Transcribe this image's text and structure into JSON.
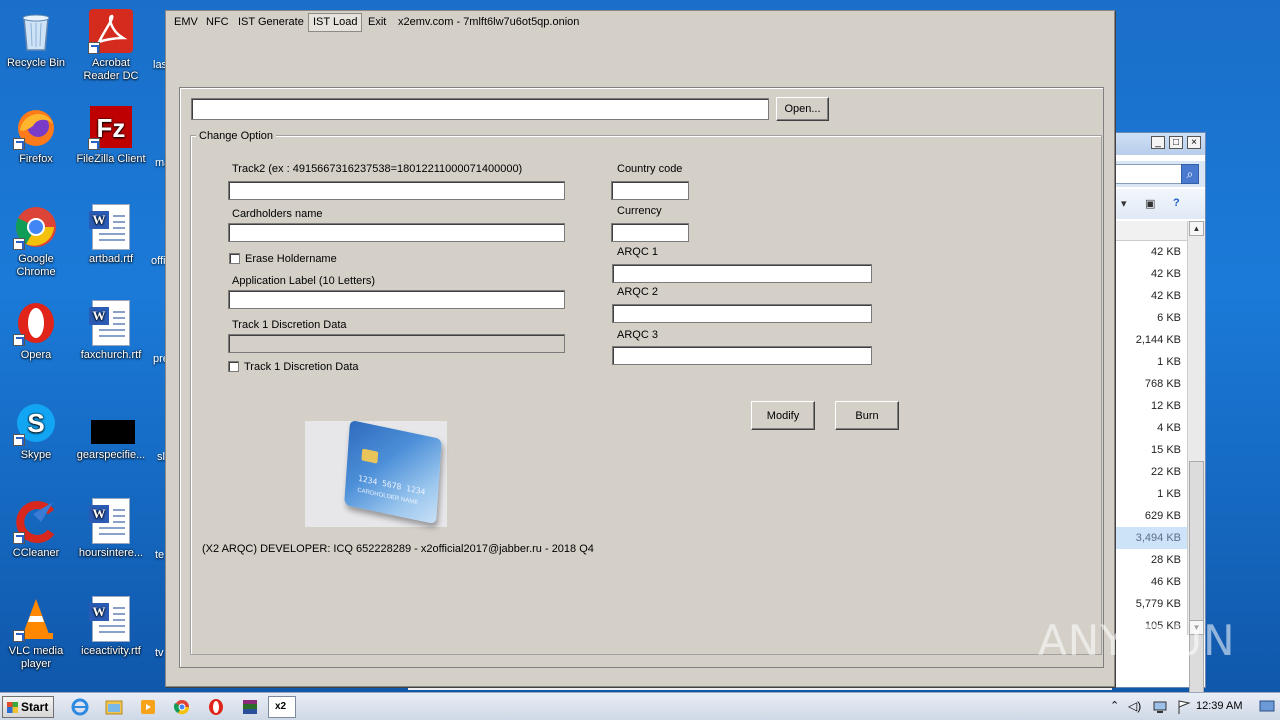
{
  "desktop": {
    "icons": [
      {
        "label": "Recycle Bin"
      },
      {
        "label": "Acrobat Reader DC"
      },
      {
        "label": "Firefox"
      },
      {
        "label": "FileZilla Client"
      },
      {
        "label": "Google Chrome"
      },
      {
        "label": "artbad.rtf"
      },
      {
        "label": "Opera"
      },
      {
        "label": "faxchurch.rtf"
      },
      {
        "label": "Skype"
      },
      {
        "label": "gearspecifie..."
      },
      {
        "label": "CCleaner"
      },
      {
        "label": "hoursintere..."
      },
      {
        "label": "VLC media player"
      },
      {
        "label": "iceactivity.rtf"
      }
    ],
    "cut_labels": [
      "las",
      "ma",
      "offi",
      "pre",
      "sl",
      "te",
      "tv"
    ]
  },
  "explorer": {
    "sizes": [
      "42 KB",
      "42 KB",
      "42 KB",
      "6 KB",
      "2,144 KB",
      "1 KB",
      "768 KB",
      "12 KB",
      "4 KB",
      "15 KB",
      "22 KB",
      "1 KB",
      "629 KB",
      "3,494 KB",
      "28 KB",
      "46 KB",
      "5,779 KB",
      "105 KB"
    ],
    "selected_index": 13
  },
  "app": {
    "menu": [
      "EMV",
      "NFC",
      "IST Generate",
      "IST Load",
      "Exit"
    ],
    "active_menu": "IST Load",
    "title": "x2emv.com - 7mlft6lw7u6ot5qp.onion",
    "path_value": "",
    "open_button": "Open...",
    "group_title": "Change Option",
    "track2_label": "Track2 (ex : 4915667316237538=18012211000071400000)",
    "track2_value": "",
    "cardholder_label": "Cardholders name",
    "cardholder_value": "",
    "erase_holdername_label": "Erase Holdername",
    "erase_holdername_checked": false,
    "app_label_label": "Application Label (10 Letters)",
    "app_label_value": "",
    "track1_disc_label": "Track 1 Discretion Data",
    "track1_disc_value": "",
    "track1_disc_check_label": "Track 1 Discretion Data",
    "track1_disc_checked": false,
    "country_code_label": "Country code",
    "country_code_value": "",
    "currency_label": "Currency",
    "currency_value": "",
    "arqc1_label": "ARQC 1",
    "arqc1_value": "",
    "arqc2_label": "ARQC 2",
    "arqc2_value": "",
    "arqc3_label": "ARQC 3",
    "arqc3_value": "",
    "modify_button": "Modify",
    "burn_button": "Burn",
    "card_number": "1234 5678 1234",
    "card_holder": "CARDHOLDER NAME",
    "developer_text": "(X2 ARQC) DEVELOPER: ICQ 652228289 - x2official2017@jabber.ru - 2018 Q4"
  },
  "taskbar": {
    "start_label": "Start",
    "active_task_label": "x2",
    "clock": "12:39 AM"
  },
  "watermark": "ANY RUN",
  "colors": {
    "window_face": "#d4d0c8",
    "desktop_blue": "#1b7ad8",
    "selection": "#cde3f7"
  }
}
